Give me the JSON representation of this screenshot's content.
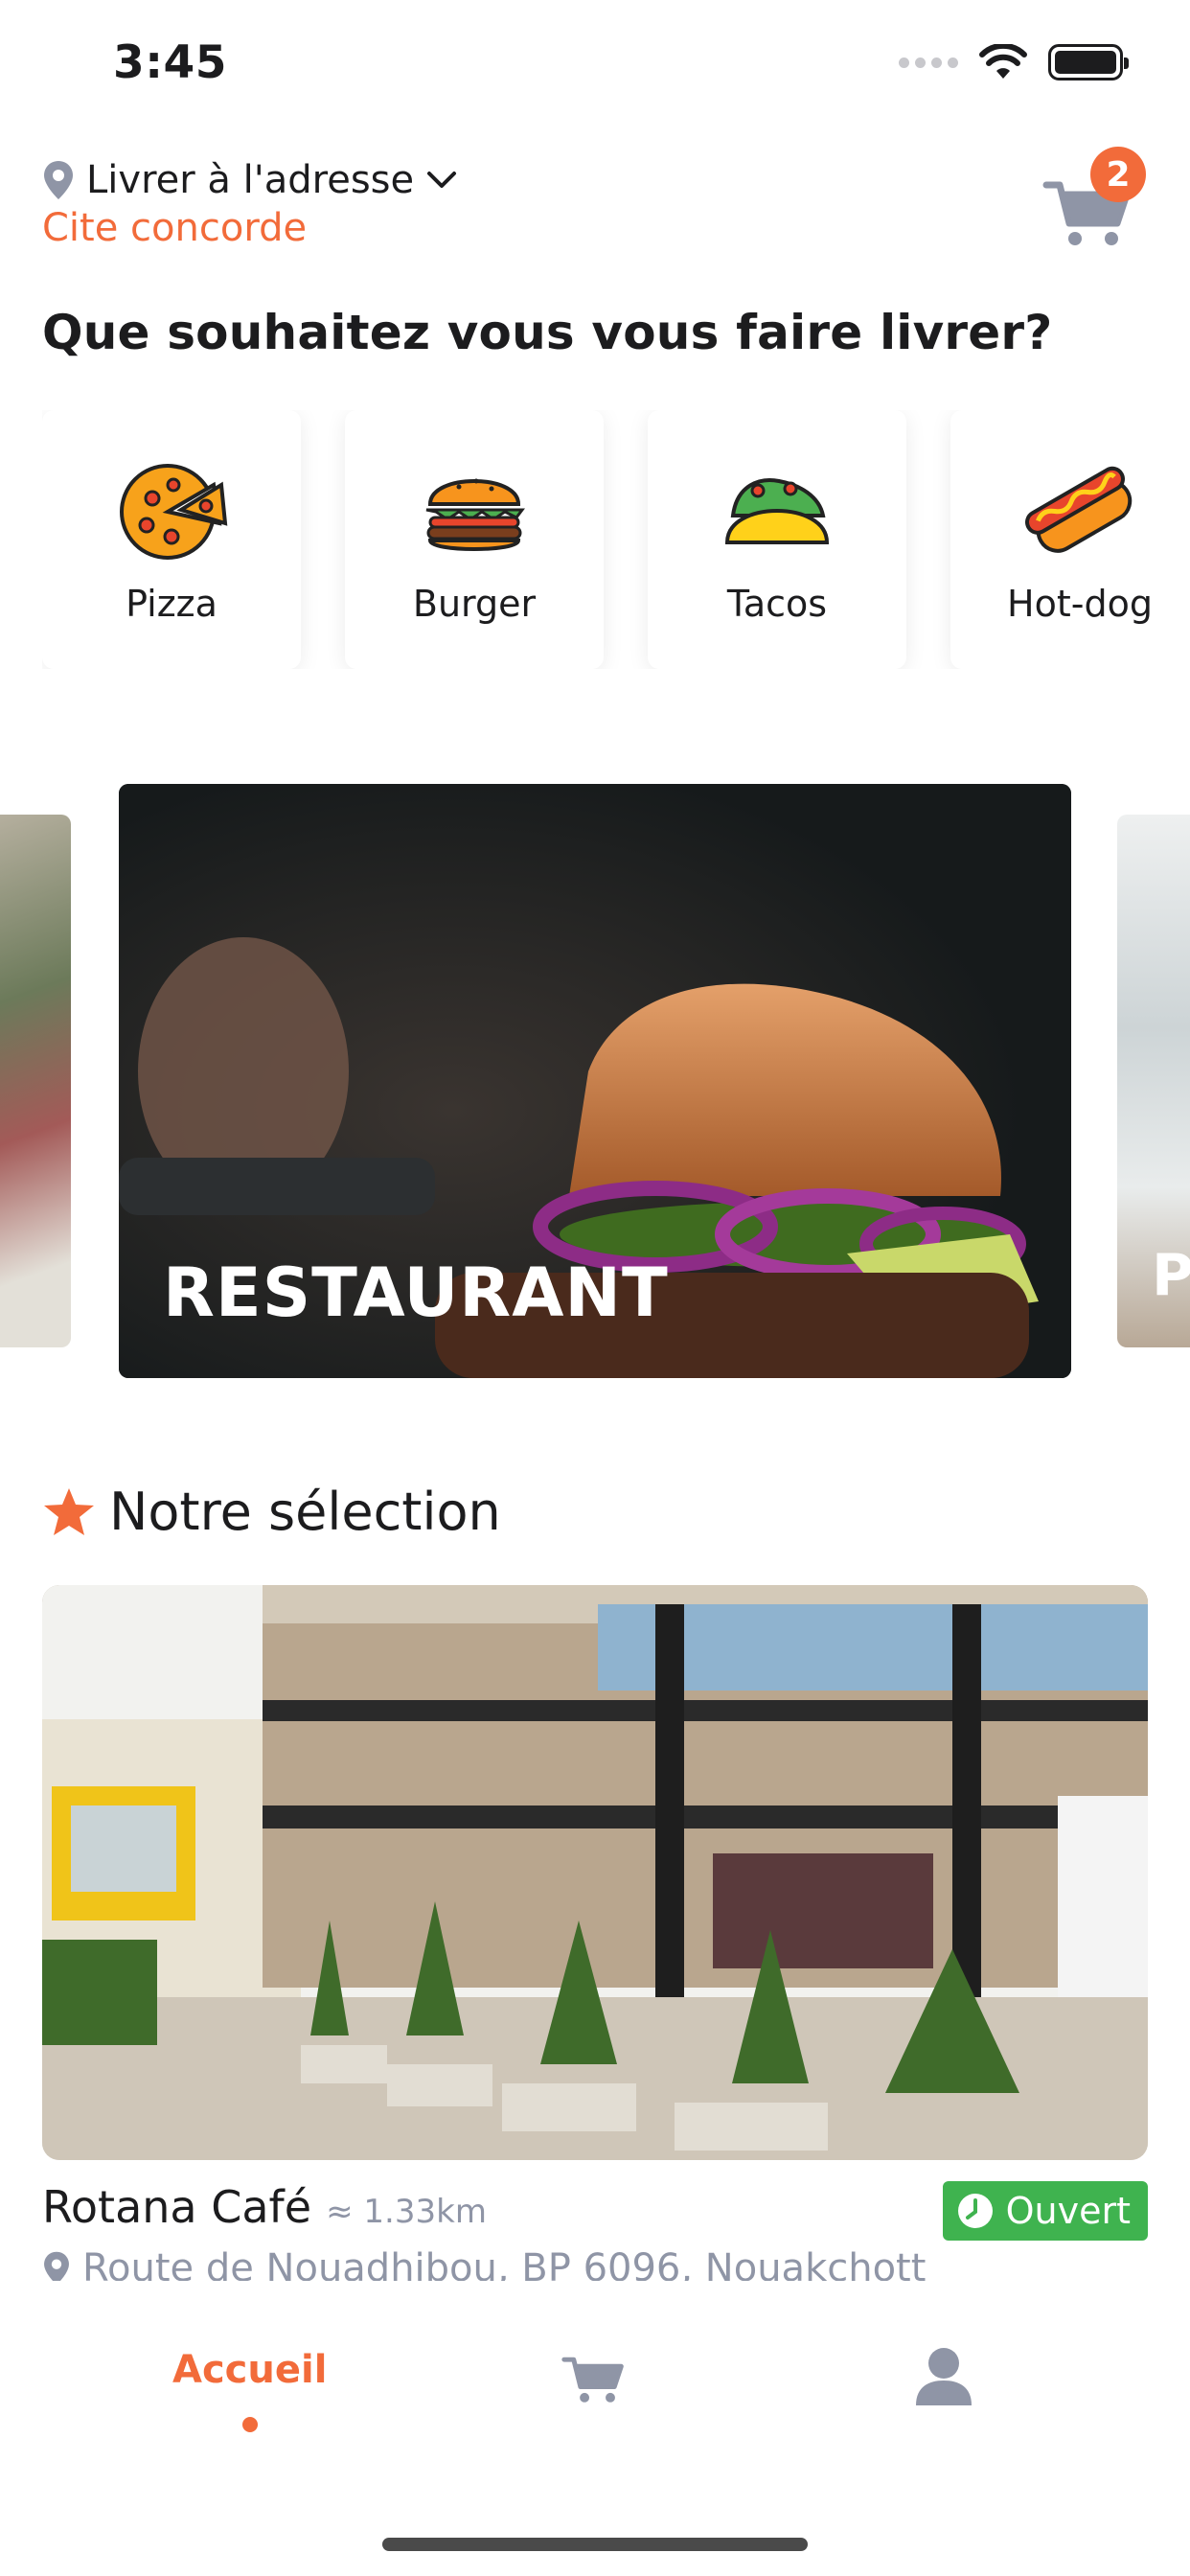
{
  "status_bar": {
    "time": "3:45"
  },
  "header": {
    "delivery_label": "Livrer à l'adresse",
    "delivery_address": "Cite concorde",
    "cart_count": "2"
  },
  "question": "Que souhaitez vous vous faire livrer?",
  "categories": [
    {
      "label": "Pizza",
      "icon": "pizza-icon"
    },
    {
      "label": "Burger",
      "icon": "burger-icon"
    },
    {
      "label": "Tacos",
      "icon": "tacos-icon"
    },
    {
      "label": "Hot-dog",
      "icon": "hotdog-icon"
    }
  ],
  "carousel": {
    "main_title": "RESTAURANT",
    "next_title_partial": "P"
  },
  "selection": {
    "title": "Notre sélection",
    "restaurant": {
      "name": "Rotana Café",
      "distance": "≈ 1.33km",
      "address": "Route de Nouadhibou, BP 6096, Nouakchott",
      "status": "Ouvert"
    }
  },
  "bottom_nav": {
    "home_label": "Accueil"
  },
  "colors": {
    "accent": "#f26b3a",
    "open_green": "#3fb34f",
    "muted": "#8f95a6"
  }
}
